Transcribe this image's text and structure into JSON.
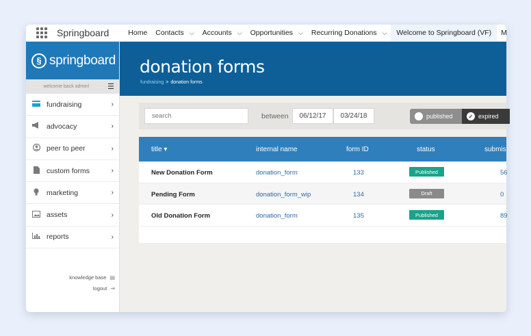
{
  "topnav": {
    "app_name": "Springboard",
    "items": [
      {
        "label": "Home",
        "dropdown": false
      },
      {
        "label": "Contacts",
        "dropdown": true
      },
      {
        "label": "Accounts",
        "dropdown": true
      },
      {
        "label": "Opportunities",
        "dropdown": true
      },
      {
        "label": "Recurring Donations",
        "dropdown": true
      },
      {
        "label": "Welcome to Springboard (VF)",
        "dropdown": false,
        "active": true
      },
      {
        "label": "Mo",
        "dropdown": false
      }
    ]
  },
  "sidebar": {
    "logo_text": "springboard",
    "welcome": "welcome back admin!",
    "items": [
      {
        "label": "fundraising",
        "icon": "card-icon"
      },
      {
        "label": "advocacy",
        "icon": "megaphone-icon"
      },
      {
        "label": "peer to peer",
        "icon": "person-icon"
      },
      {
        "label": "custom forms",
        "icon": "document-icon"
      },
      {
        "label": "marketing",
        "icon": "bulb-icon"
      },
      {
        "label": "assets",
        "icon": "images-icon"
      },
      {
        "label": "reports",
        "icon": "bar-chart-icon"
      }
    ],
    "knowledge_base": "knowledge base",
    "logout": "logout"
  },
  "header": {
    "title": "donation forms",
    "breadcrumb_parent": "fundraising",
    "breadcrumb_sep": ">",
    "breadcrumb_current": "donation forms"
  },
  "filters": {
    "search_placeholder": "search",
    "between_label": "between",
    "date_from": "06/12/17",
    "date_to": "03/24/18",
    "published_label": "published",
    "expired_label": "expired"
  },
  "table": {
    "columns": {
      "title": "title",
      "title_sort_icon": "▾",
      "internal_name": "internal name",
      "form_id": "form ID",
      "status": "status",
      "submissions": "submis"
    },
    "rows": [
      {
        "title": "New Donation Form",
        "internal_name": "donation_form",
        "form_id": "133",
        "status": "Published",
        "status_color": "#1aa38a",
        "submissions": "56"
      },
      {
        "title": "Pending Form",
        "internal_name": "donation_form_wip",
        "form_id": "134",
        "status": "Draft",
        "status_color": "#8a8a8a",
        "submissions": "0"
      },
      {
        "title": "Old Donation Form",
        "internal_name": "donation_form",
        "form_id": "135",
        "status": "Published",
        "status_color": "#1aa38a",
        "submissions": "89"
      }
    ]
  }
}
